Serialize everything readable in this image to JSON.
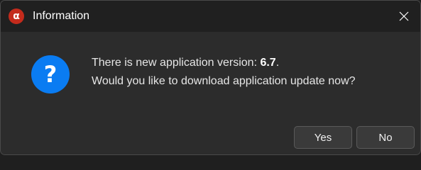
{
  "window": {
    "title": "Information",
    "app_icon_glyph": "α",
    "close_icon": "close-icon"
  },
  "message": {
    "line1_prefix": "There is new application version: ",
    "version": "6.7",
    "line1_suffix": ".",
    "line2": "Would you like to download application update now?"
  },
  "icon": {
    "type": "question-icon",
    "glyph": "?",
    "color": "#0a7cf2"
  },
  "buttons": {
    "yes_label": "Yes",
    "no_label": "No"
  },
  "colors": {
    "app_icon": "#c42b1c",
    "background": "#2c2c2c",
    "titlebar": "#202020"
  }
}
